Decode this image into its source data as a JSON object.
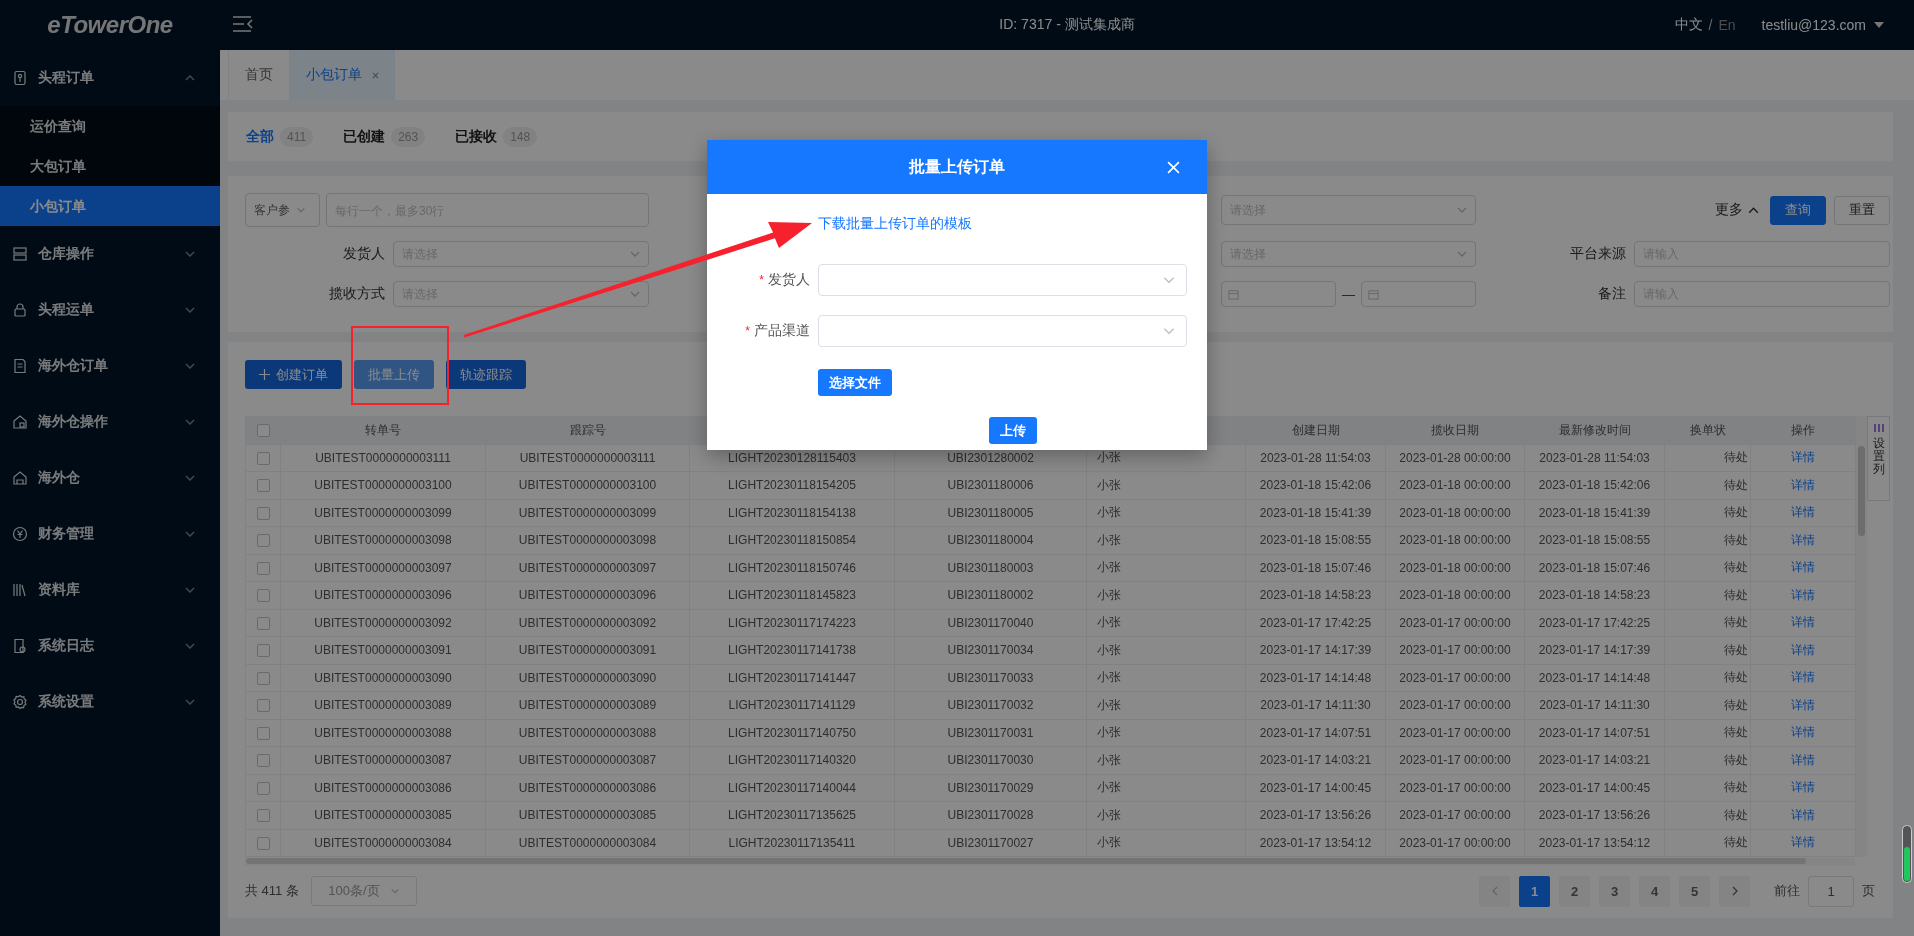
{
  "topbar": {
    "logo": "eTowerOne",
    "title": "ID: 7317 - 测试集成商",
    "language": {
      "options": [
        {
          "label": "中文",
          "selected": true
        },
        {
          "label": "En",
          "selected": false
        }
      ],
      "separator": "/"
    },
    "user": "testliu@123.com"
  },
  "sidebar": {
    "items": [
      {
        "label": "头程订单",
        "selected": false,
        "expanded": true,
        "children": [
          {
            "label": "运价查询",
            "selected": false
          },
          {
            "label": "大包订单",
            "selected": false
          },
          {
            "label": "小包订单",
            "selected": true
          }
        ]
      },
      {
        "label": "仓库操作",
        "selected": false,
        "expanded": false
      },
      {
        "label": "头程运单",
        "selected": false,
        "expanded": false
      },
      {
        "label": "海外仓订单",
        "selected": false,
        "expanded": false
      },
      {
        "label": "海外仓操作",
        "selected": false,
        "expanded": false
      },
      {
        "label": "海外仓",
        "selected": false,
        "expanded": false
      },
      {
        "label": "财务管理",
        "selected": false,
        "expanded": false
      },
      {
        "label": "资料库",
        "selected": false,
        "expanded": false
      },
      {
        "label": "系统日志",
        "selected": false,
        "expanded": false
      },
      {
        "label": "系统设置",
        "selected": false,
        "expanded": false
      }
    ]
  },
  "page_tabs": [
    {
      "label": "首页",
      "selected": false,
      "closable": false
    },
    {
      "label": "小包订单",
      "selected": true,
      "closable": true
    }
  ],
  "status_tabs": [
    {
      "label": "全部",
      "count": "411",
      "selected": true
    },
    {
      "label": "已创建",
      "count": "263",
      "selected": false
    },
    {
      "label": "已接收",
      "count": "148",
      "selected": false
    }
  ],
  "filters": {
    "rows": [
      [
        {
          "kind": "combo",
          "select_value": "客户参",
          "placeholder": "每行一个，最多30行"
        },
        {
          "kind": "blank"
        },
        {
          "kind": "select",
          "placeholder": "请选择"
        },
        {
          "kind": "actions"
        }
      ],
      [
        {
          "kind": "select",
          "label": "发货人",
          "placeholder": "请选择"
        },
        {
          "kind": "blank"
        },
        {
          "kind": "select",
          "placeholder": "请选择"
        },
        {
          "kind": "input",
          "label": "平台来源",
          "placeholder": "请输入"
        }
      ],
      [
        {
          "kind": "select",
          "label": "揽收方式",
          "placeholder": "请选择"
        },
        {
          "kind": "blank"
        },
        {
          "kind": "daterange",
          "separator": "—"
        },
        {
          "kind": "input",
          "label": "备注",
          "placeholder": "请输入"
        }
      ]
    ],
    "more": {
      "label": "更多",
      "expanded": true
    },
    "buttons": [
      {
        "label": "查询",
        "kind": "primary"
      },
      {
        "label": "重置",
        "kind": "default"
      }
    ]
  },
  "toolbar": [
    {
      "label": "创建订单",
      "kind": "create"
    },
    {
      "label": "批量上传",
      "kind": "upload"
    },
    {
      "label": "轨迹跟踪",
      "kind": "track"
    }
  ],
  "table": {
    "all_checked": false,
    "columns": [
      {
        "label": "转单号"
      },
      {
        "label": "跟踪号"
      },
      {},
      {},
      {},
      {
        "label": "创建日期"
      },
      {
        "label": "揽收日期"
      },
      {
        "label": "最新修改时间"
      },
      {
        "label": "换单状"
      },
      {
        "label": "操作"
      }
    ],
    "rows": [
      {
        "checked": false,
        "cells": [
          "UBITEST0000000003111",
          "UBITEST0000000003111",
          "LIGHT20230128115403",
          "UBI2301280002",
          "小张",
          "2023-01-28 11:54:03",
          "2023-01-28 00:00:00",
          "2023-01-28 11:54:03",
          "待处",
          "详情"
        ]
      },
      {
        "checked": false,
        "cells": [
          "UBITEST0000000003100",
          "UBITEST0000000003100",
          "LIGHT20230118154205",
          "UBI2301180006",
          "小张",
          "2023-01-18 15:42:06",
          "2023-01-18 00:00:00",
          "2023-01-18 15:42:06",
          "待处",
          "详情"
        ]
      },
      {
        "checked": false,
        "cells": [
          "UBITEST0000000003099",
          "UBITEST0000000003099",
          "LIGHT20230118154138",
          "UBI2301180005",
          "小张",
          "2023-01-18 15:41:39",
          "2023-01-18 00:00:00",
          "2023-01-18 15:41:39",
          "待处",
          "详情"
        ]
      },
      {
        "checked": false,
        "cells": [
          "UBITEST0000000003098",
          "UBITEST0000000003098",
          "LIGHT20230118150854",
          "UBI2301180004",
          "小张",
          "2023-01-18 15:08:55",
          "2023-01-18 00:00:00",
          "2023-01-18 15:08:55",
          "待处",
          "详情"
        ]
      },
      {
        "checked": false,
        "cells": [
          "UBITEST0000000003097",
          "UBITEST0000000003097",
          "LIGHT20230118150746",
          "UBI2301180003",
          "小张",
          "2023-01-18 15:07:46",
          "2023-01-18 00:00:00",
          "2023-01-18 15:07:46",
          "待处",
          "详情"
        ]
      },
      {
        "checked": false,
        "cells": [
          "UBITEST0000000003096",
          "UBITEST0000000003096",
          "LIGHT20230118145823",
          "UBI2301180002",
          "小张",
          "2023-01-18 14:58:23",
          "2023-01-18 00:00:00",
          "2023-01-18 14:58:23",
          "待处",
          "详情"
        ]
      },
      {
        "checked": false,
        "cells": [
          "UBITEST0000000003092",
          "UBITEST0000000003092",
          "LIGHT20230117174223",
          "UBI2301170040",
          "小张",
          "2023-01-17 17:42:25",
          "2023-01-17 00:00:00",
          "2023-01-17 17:42:25",
          "待处",
          "详情"
        ]
      },
      {
        "checked": false,
        "cells": [
          "UBITEST0000000003091",
          "UBITEST0000000003091",
          "LIGHT20230117141738",
          "UBI2301170034",
          "小张",
          "2023-01-17 14:17:39",
          "2023-01-17 00:00:00",
          "2023-01-17 14:17:39",
          "待处",
          "详情"
        ]
      },
      {
        "checked": false,
        "cells": [
          "UBITEST0000000003090",
          "UBITEST0000000003090",
          "LIGHT20230117141447",
          "UBI2301170033",
          "小张",
          "2023-01-17 14:14:48",
          "2023-01-17 00:00:00",
          "2023-01-17 14:14:48",
          "待处",
          "详情"
        ]
      },
      {
        "checked": false,
        "cells": [
          "UBITEST0000000003089",
          "UBITEST0000000003089",
          "LIGHT20230117141129",
          "UBI2301170032",
          "小张",
          "2023-01-17 14:11:30",
          "2023-01-17 00:00:00",
          "2023-01-17 14:11:30",
          "待处",
          "详情"
        ]
      },
      {
        "checked": false,
        "cells": [
          "UBITEST0000000003088",
          "UBITEST0000000003088",
          "LIGHT20230117140750",
          "UBI2301170031",
          "小张",
          "2023-01-17 14:07:51",
          "2023-01-17 00:00:00",
          "2023-01-17 14:07:51",
          "待处",
          "详情"
        ]
      },
      {
        "checked": false,
        "cells": [
          "UBITEST0000000003087",
          "UBITEST0000000003087",
          "LIGHT20230117140320",
          "UBI2301170030",
          "小张",
          "2023-01-17 14:03:21",
          "2023-01-17 00:00:00",
          "2023-01-17 14:03:21",
          "待处",
          "详情"
        ]
      },
      {
        "checked": false,
        "cells": [
          "UBITEST0000000003086",
          "UBITEST0000000003086",
          "LIGHT20230117140044",
          "UBI2301170029",
          "小张",
          "2023-01-17 14:00:45",
          "2023-01-17 00:00:00",
          "2023-01-17 14:00:45",
          "待处",
          "详情"
        ]
      },
      {
        "checked": false,
        "cells": [
          "UBITEST0000000003085",
          "UBITEST0000000003085",
          "LIGHT20230117135625",
          "UBI2301170028",
          "小张",
          "2023-01-17 13:56:26",
          "2023-01-17 00:00:00",
          "2023-01-17 13:56:26",
          "待处",
          "详情"
        ]
      },
      {
        "checked": false,
        "cells": [
          "UBITEST0000000003084",
          "UBITEST0000000003084",
          "LIGHT20230117135411",
          "UBI2301170027",
          "小张",
          "2023-01-17 13:54:12",
          "2023-01-17 00:00:00",
          "2023-01-17 13:54:12",
          "待处",
          "详情"
        ]
      }
    ],
    "column_settings": "设置列"
  },
  "pagination": {
    "total": "共 411 条",
    "page_size": "100条/页",
    "pages": [
      {
        "label": "1",
        "selected": true
      },
      {
        "label": "2",
        "selected": false
      },
      {
        "label": "3",
        "selected": false
      },
      {
        "label": "4",
        "selected": false
      },
      {
        "label": "5",
        "selected": false
      }
    ],
    "goto_label": "前往",
    "goto_value": "1",
    "goto_suffix": "页"
  },
  "dialog": {
    "title": "批量上传订单",
    "template_link": "下载批量上传订单的模板",
    "fields": [
      {
        "label": "发货人",
        "required_mark": "*"
      },
      {
        "label": "产品渠道",
        "required_mark": "*"
      }
    ],
    "choose_file": "选择文件",
    "submit": "上传"
  }
}
